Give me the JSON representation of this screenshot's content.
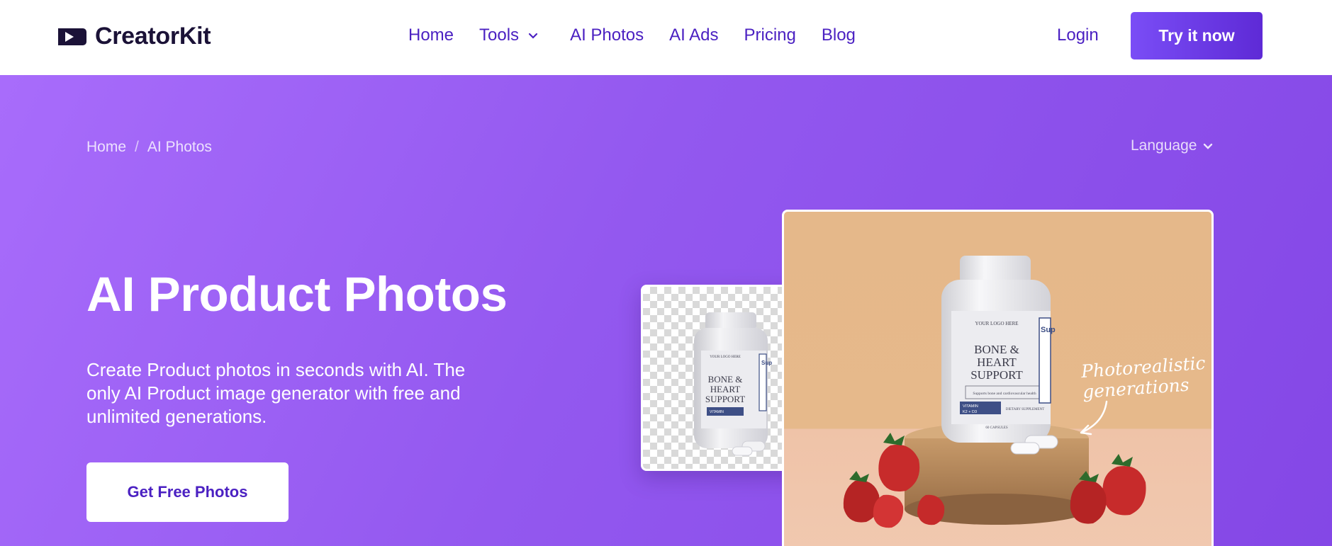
{
  "header": {
    "brand": "CreatorKit",
    "nav": [
      {
        "label": "Home"
      },
      {
        "label": "Tools",
        "has_dropdown": true
      },
      {
        "label": "AI Photos"
      },
      {
        "label": "AI Ads"
      },
      {
        "label": "Pricing"
      },
      {
        "label": "Blog"
      }
    ],
    "login_label": "Login",
    "cta_label": "Try it now"
  },
  "hero": {
    "breadcrumb": [
      "Home",
      "AI Photos"
    ],
    "breadcrumb_separator": "/",
    "language_label": "Language",
    "title": "AI Product Photos",
    "description": "Create Product photos in seconds with AI. The only AI Product image generator with free and unlimited generations.",
    "cta_label": "Get Free Photos",
    "image_caption_line1": "Photorealistic",
    "image_caption_line2": "generations"
  },
  "product": {
    "logo_text": "YOUR LOGO HERE",
    "name_line1": "BONE &",
    "name_line2": "HEART",
    "name_line3": "SUPPORT",
    "tagline": "Supports bone and cardiovascular health",
    "vitamin": "VITAMIN",
    "vitamin_detail": "K2 + D3",
    "supplement": "DIETARY SUPPLEMENT",
    "count": "60 CAPSULES",
    "side": "Sup"
  },
  "colors": {
    "brand_purple": "#4b21c2",
    "hero_start": "#a86cfb",
    "hero_end": "#8447e6",
    "button_gradient_start": "#7a4df6",
    "button_gradient_end": "#5e2ad6"
  }
}
